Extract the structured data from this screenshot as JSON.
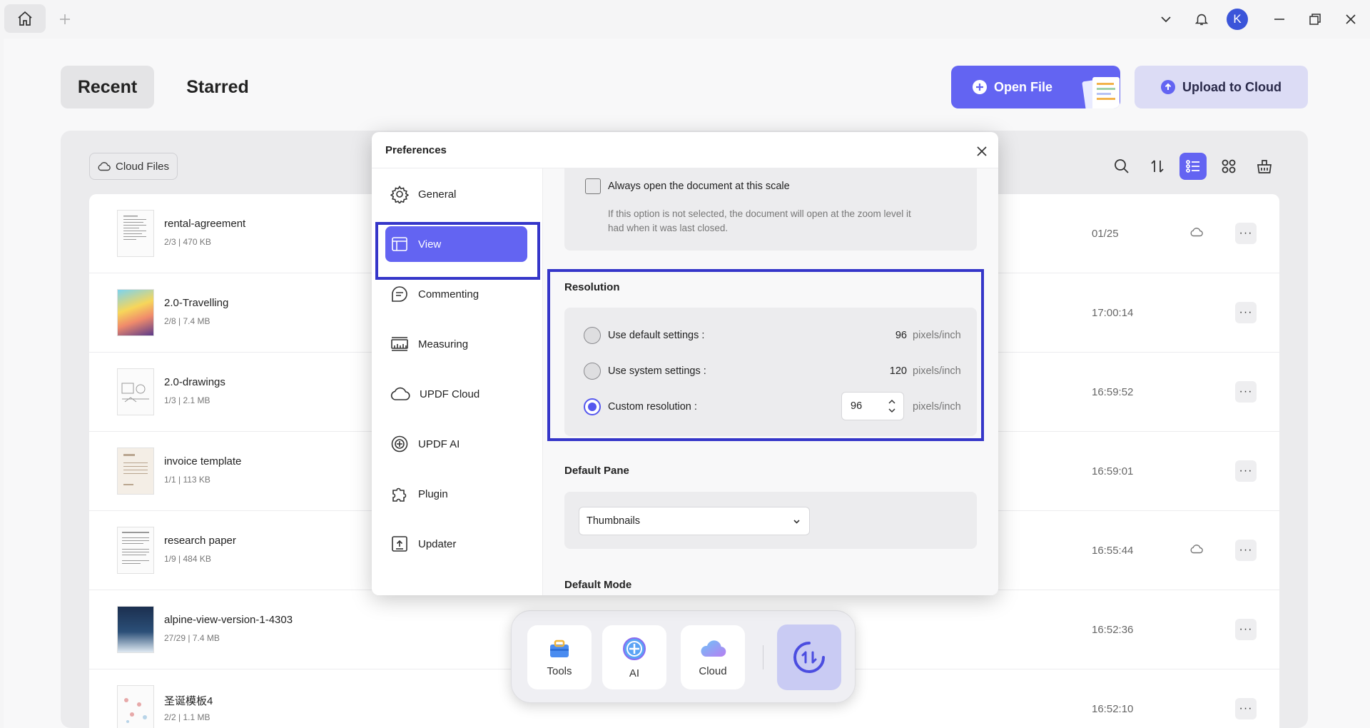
{
  "titlebar": {
    "avatar_initial": "K"
  },
  "tabs": {
    "recent": "Recent",
    "starred": "Starred"
  },
  "actions": {
    "open_file": "Open File",
    "upload_cloud": "Upload to Cloud"
  },
  "toolbar": {
    "cloud_files": "Cloud Files"
  },
  "files": [
    {
      "name": "rental-agreement",
      "meta": "2/3 | 470 KB",
      "time": "01/25",
      "cloud": true
    },
    {
      "name": "2.0-Travelling",
      "meta": "2/8 | 7.4 MB",
      "time": "17:00:14",
      "cloud": false
    },
    {
      "name": "2.0-drawings",
      "meta": "1/3 | 2.1 MB",
      "time": "16:59:52",
      "cloud": false
    },
    {
      "name": "invoice template",
      "meta": "1/1 | 113 KB",
      "time": "16:59:01",
      "cloud": false
    },
    {
      "name": "research paper",
      "meta": "1/9 | 484 KB",
      "time": "16:55:44",
      "cloud": true
    },
    {
      "name": "alpine-view-version-1-4303",
      "meta": "27/29 | 7.4 MB",
      "time": "16:52:36",
      "cloud": false
    },
    {
      "name": "圣诞模板4",
      "meta": "2/2 | 1.1 MB",
      "time": "16:52:10",
      "cloud": false
    }
  ],
  "more_glyph": "···",
  "dock": {
    "tools": "Tools",
    "ai": "AI",
    "cloud": "Cloud"
  },
  "preferences": {
    "title": "Preferences",
    "nav": [
      "General",
      "View",
      "Commenting",
      "Measuring",
      "UPDF Cloud",
      "UPDF AI",
      "Plugin",
      "Updater"
    ],
    "active_nav": "View",
    "scale": {
      "checkbox_label": "Always open the document at this scale",
      "checked": false,
      "hint_line1": "If this option is not selected, the document will open at the zoom level it",
      "hint_line2": "had when it was last closed."
    },
    "resolution": {
      "title": "Resolution",
      "default_label": "Use default settings :",
      "default_value": "96",
      "system_label": "Use system settings :",
      "system_value": "120",
      "custom_label": "Custom resolution :",
      "custom_value": "96",
      "unit": "pixels/inch",
      "selected": "custom"
    },
    "default_pane": {
      "title": "Default Pane",
      "value": "Thumbnails"
    },
    "default_mode": {
      "title": "Default Mode"
    }
  },
  "colors": {
    "accent": "#6364f2",
    "highlight_border": "#3536c9",
    "upload_bg": "#dcdcf5"
  }
}
